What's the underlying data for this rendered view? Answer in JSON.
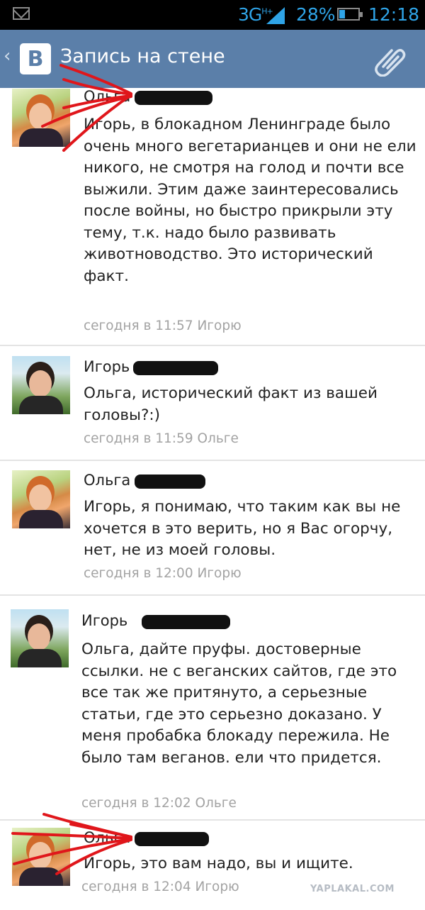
{
  "status_bar": {
    "network": "3G",
    "network_sup": "H+",
    "battery": "28%",
    "time": "12:18"
  },
  "header": {
    "back": "‹",
    "logo": "B",
    "title": "Запись на стене"
  },
  "comments": [
    {
      "author": "Ольга",
      "text": "Игорь, в блокадном Ленинграде было очень много вегетарианцев и они не ели никого, не смотря на голод и почти все выжили. Этим даже заинтересовались после войны, но быстро прикрыли эту тему, т.к. надо было развивать животноводство. Это исторический факт.",
      "meta": "сегодня в 11:57 Игорю"
    },
    {
      "author": "Игорь",
      "text": "Ольга, исторический факт из вашей головы?:)",
      "meta": "сегодня в 11:59 Ольге"
    },
    {
      "author": "Ольга",
      "text": "Игорь, я понимаю, что таким как вы не хочется в это верить, но я Вас огорчу, нет, не из моей головы.",
      "meta": "сегодня в 12:00 Игорю"
    },
    {
      "author": "Игорь",
      "text": "Ольга, дайте пруфы. достоверные ссылки. не с веганских сайтов, где это все так же притянуто, а серьезные статьи, где это серьезно доказано. У меня пробабка блокаду пережила. Не было там веганов. ели что придется.",
      "meta": "сегодня в 12:02 Ольге"
    },
    {
      "author": "Ольга",
      "text": "Игорь, это вам надо, вы и ищите.",
      "meta": "сегодня в 12:04 Игорю"
    }
  ],
  "watermark": "YAPLAKAL.COM",
  "colors": {
    "header_bg": "#5b7fa9",
    "meta_text": "#a3a3a3",
    "status_accent": "#2fa4e7",
    "annotation_red": "#e0161b"
  },
  "icons": {
    "status_left": "mail-icon",
    "header_right": "paperclip-icon"
  }
}
